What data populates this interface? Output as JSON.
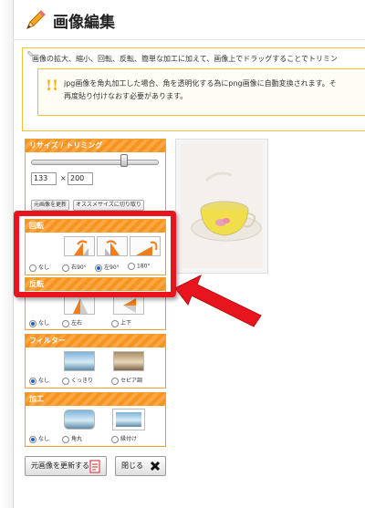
{
  "header": {
    "title": "画像編集"
  },
  "description": {
    "line1": "画像の拡大、縮小、回転、反転、簡単な加工に加えて、画像上でドラッグすることでトリミン",
    "note_mark": "!!",
    "note_line1": "jpg画像を角丸加工した場合、角を透明化する為にpng画像に自動変換されます。そ",
    "note_line2": "再度貼り付けなおす必要があります。"
  },
  "resize": {
    "title": "リサイズ / トリミング",
    "slider_value": 0.74,
    "width": "133",
    "height": "200",
    "times": "×",
    "btn_restore": "元画像を更新",
    "btn_recommend": "オススメサイズに切り取り"
  },
  "rotate": {
    "title": "回転",
    "options": [
      "なし",
      "右90°",
      "左90°",
      "180°"
    ],
    "selected": "左90°"
  },
  "flip": {
    "title": "反転",
    "options": [
      "なし",
      "左右",
      "上下"
    ],
    "selected": "なし"
  },
  "filter": {
    "title": "フィルター",
    "options": [
      "なし",
      "くっきり",
      "セピア調"
    ],
    "selected": "なし"
  },
  "process": {
    "title": "加工",
    "options": [
      "なし",
      "角丸",
      "縁付け"
    ],
    "selected": "なし"
  },
  "footer": {
    "update_button": "元画像を更新する",
    "close_button": "閉じる"
  },
  "colors": {
    "accent": "#f7931e",
    "highlight": "#e8141e",
    "note_border": "#f1c232"
  }
}
